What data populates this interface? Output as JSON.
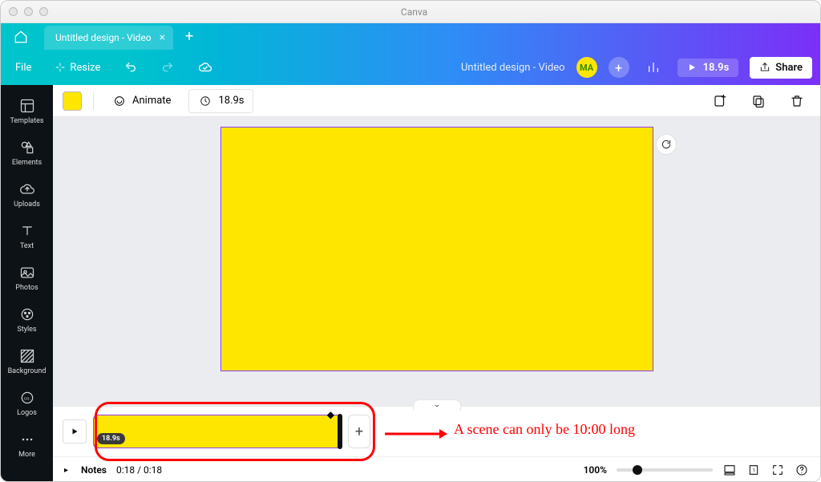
{
  "window": {
    "title": "Canva"
  },
  "tabs": {
    "document": "Untitled design - Video"
  },
  "toolbar": {
    "file": "File",
    "resize": "Resize",
    "doc_title": "Untitled design - Video",
    "avatar_initials": "MA",
    "play_duration": "18.9s",
    "share": "Share"
  },
  "side_rail": {
    "items": [
      {
        "id": "templates",
        "label": "Templates"
      },
      {
        "id": "elements",
        "label": "Elements"
      },
      {
        "id": "uploads",
        "label": "Uploads"
      },
      {
        "id": "text",
        "label": "Text"
      },
      {
        "id": "photos",
        "label": "Photos"
      },
      {
        "id": "styles",
        "label": "Styles"
      },
      {
        "id": "background",
        "label": "Background"
      },
      {
        "id": "logos",
        "label": "Logos"
      },
      {
        "id": "more",
        "label": "More"
      }
    ]
  },
  "context_bar": {
    "color": "#ffe600",
    "animate": "Animate",
    "duration": "18.9s"
  },
  "timeline": {
    "clip_duration_badge": "18.9s"
  },
  "footer": {
    "notes": "Notes",
    "time": "0:18 / 0:18",
    "zoom": "100%"
  },
  "annotation": {
    "text": "A scene can only be 10:00 long"
  }
}
